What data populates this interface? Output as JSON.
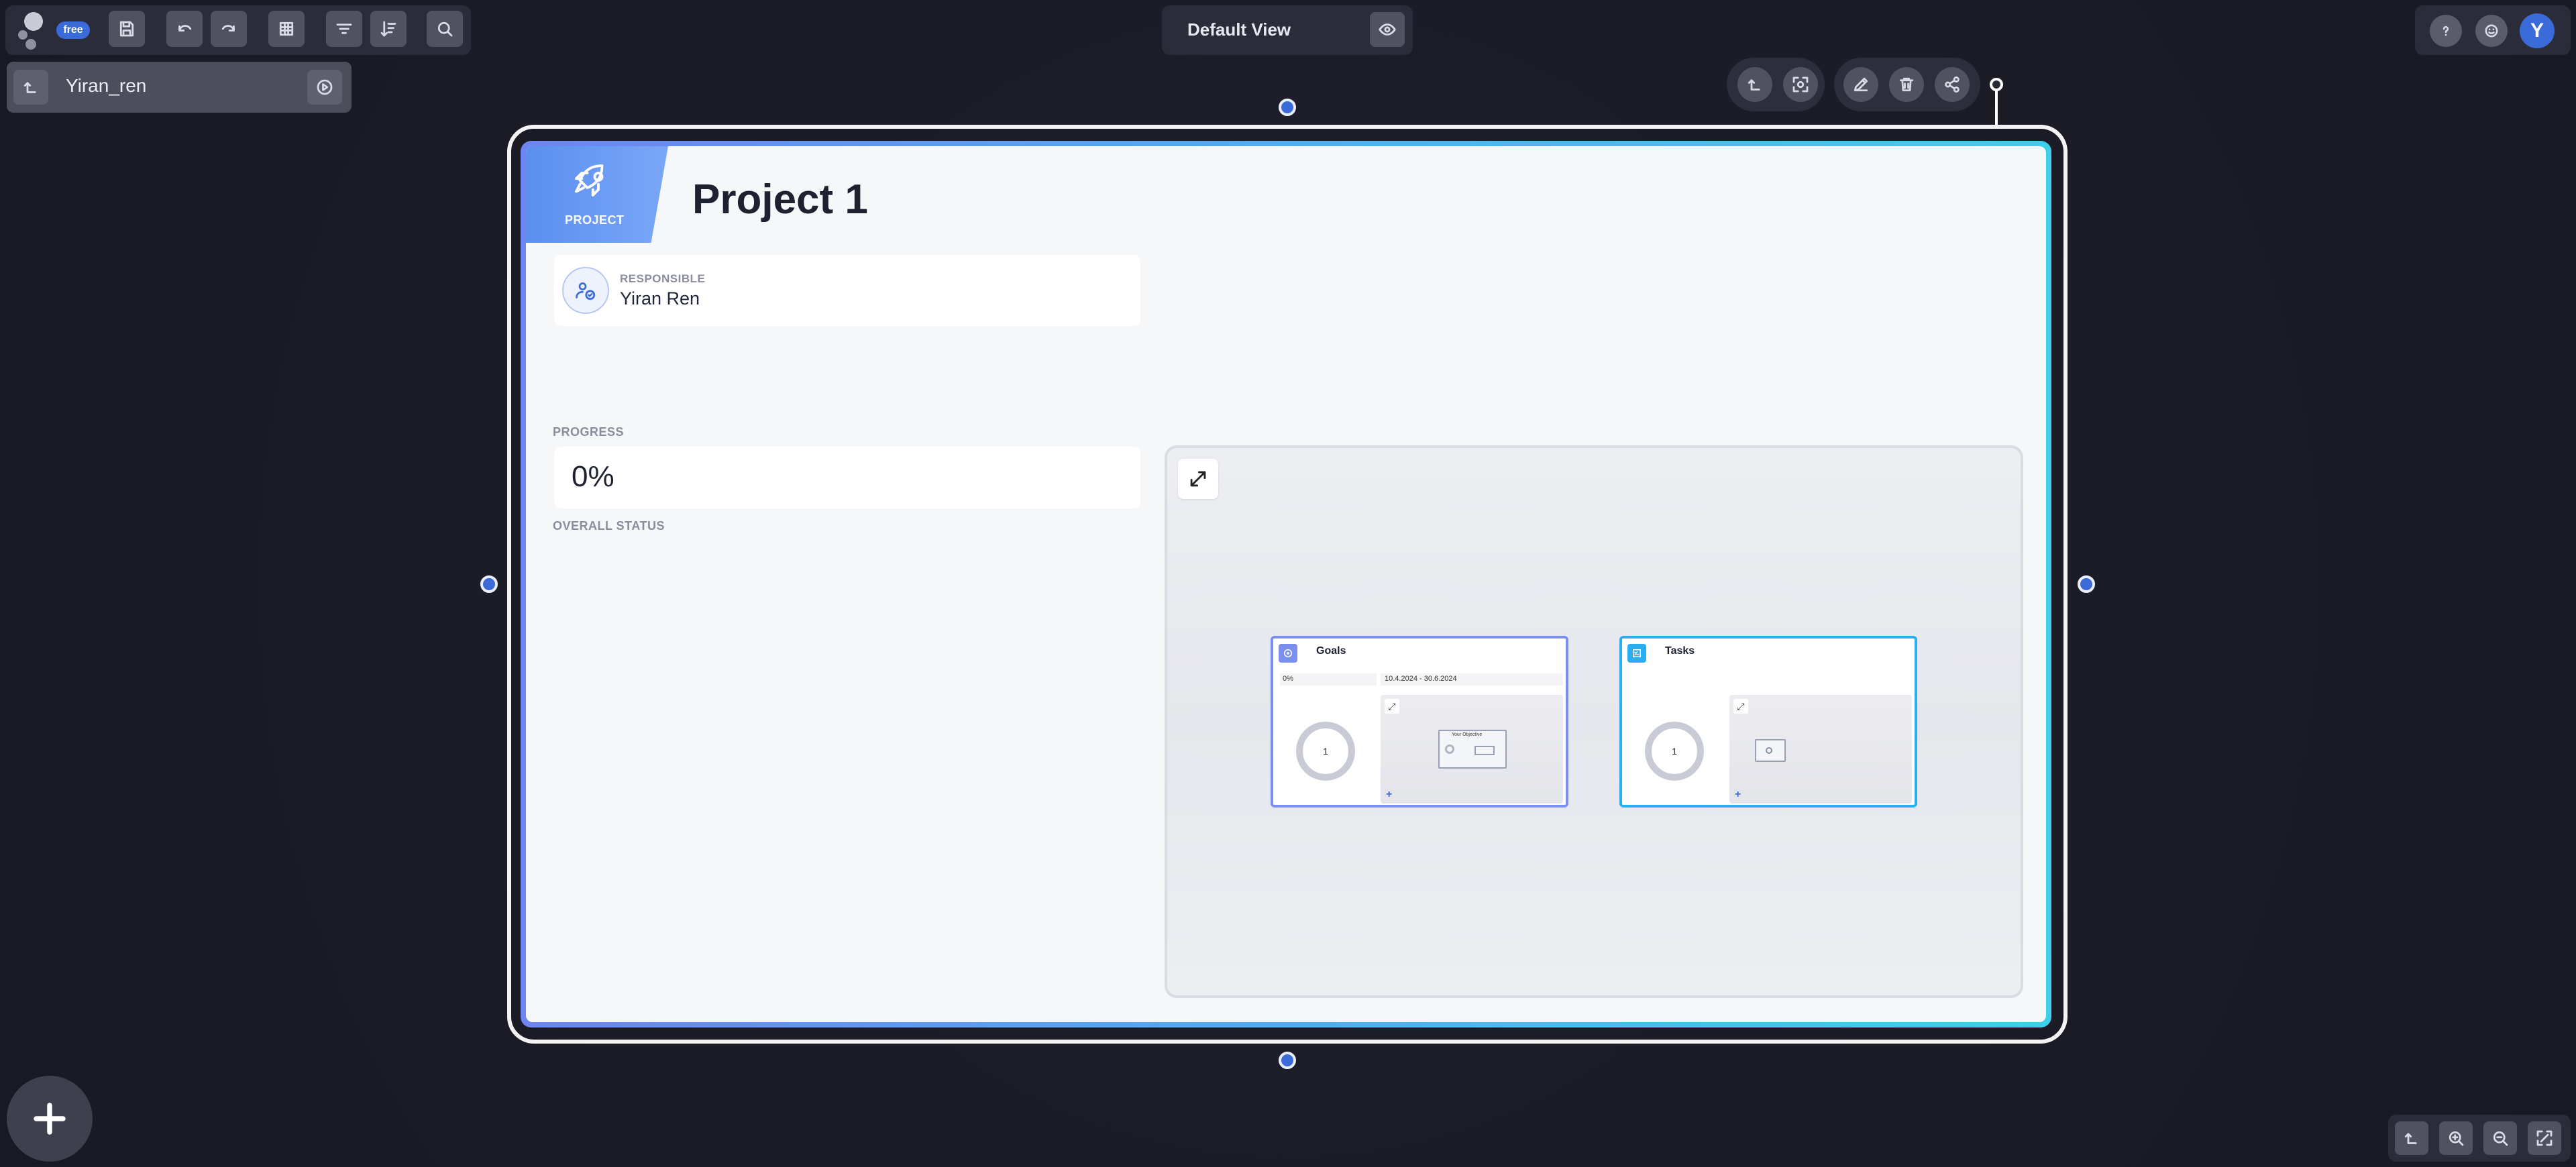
{
  "app": {
    "plan_badge": "free",
    "avatar_initial": "Y",
    "accent": "#3b6bd8"
  },
  "toolbar_left": {
    "icons": [
      "logo-icon",
      "save-icon",
      "undo-icon",
      "redo-icon",
      "grid-icon",
      "filter-icon",
      "sort-icon",
      "search-icon"
    ]
  },
  "view": {
    "name": "Default View",
    "icon": "eye-icon"
  },
  "toolbar_right": {
    "icons": [
      "help-icon",
      "smiley-icon"
    ]
  },
  "breadcrumb": {
    "label": "Yiran_ren",
    "icons": [
      "level-up-icon",
      "play-circle-icon"
    ]
  },
  "node_toolbar": {
    "icons": [
      "level-up-icon",
      "focus-icon",
      "edit-icon",
      "delete-icon",
      "share-icon"
    ]
  },
  "project": {
    "type_label": "PROJECT",
    "title": "Project 1",
    "responsible_label": "RESPONSIBLE",
    "responsible_name": "Yiran Ren",
    "progress_label": "PROGRESS",
    "progress_value": "0%",
    "overall_status_label": "OVERALL STATUS",
    "header_gradient": [
      "#5b8ff0",
      "#7aa7f7"
    ],
    "frame_gradient": [
      "#6e84f0",
      "#3ed0e8"
    ]
  },
  "subnodes": [
    {
      "title": "Goals",
      "percent": "0%",
      "date_range": "10.4.2024 - 30.6.2024",
      "count": "1",
      "inner_title": "Your Objective",
      "color": "#7b8ff0"
    },
    {
      "title": "Tasks",
      "count": "1",
      "color": "#2aaef0"
    }
  ],
  "zoom_controls": {
    "icons": [
      "level-up-icon",
      "zoom-in-icon",
      "zoom-out-icon",
      "fit-icon"
    ]
  },
  "fab": {
    "icon": "plus-icon"
  }
}
